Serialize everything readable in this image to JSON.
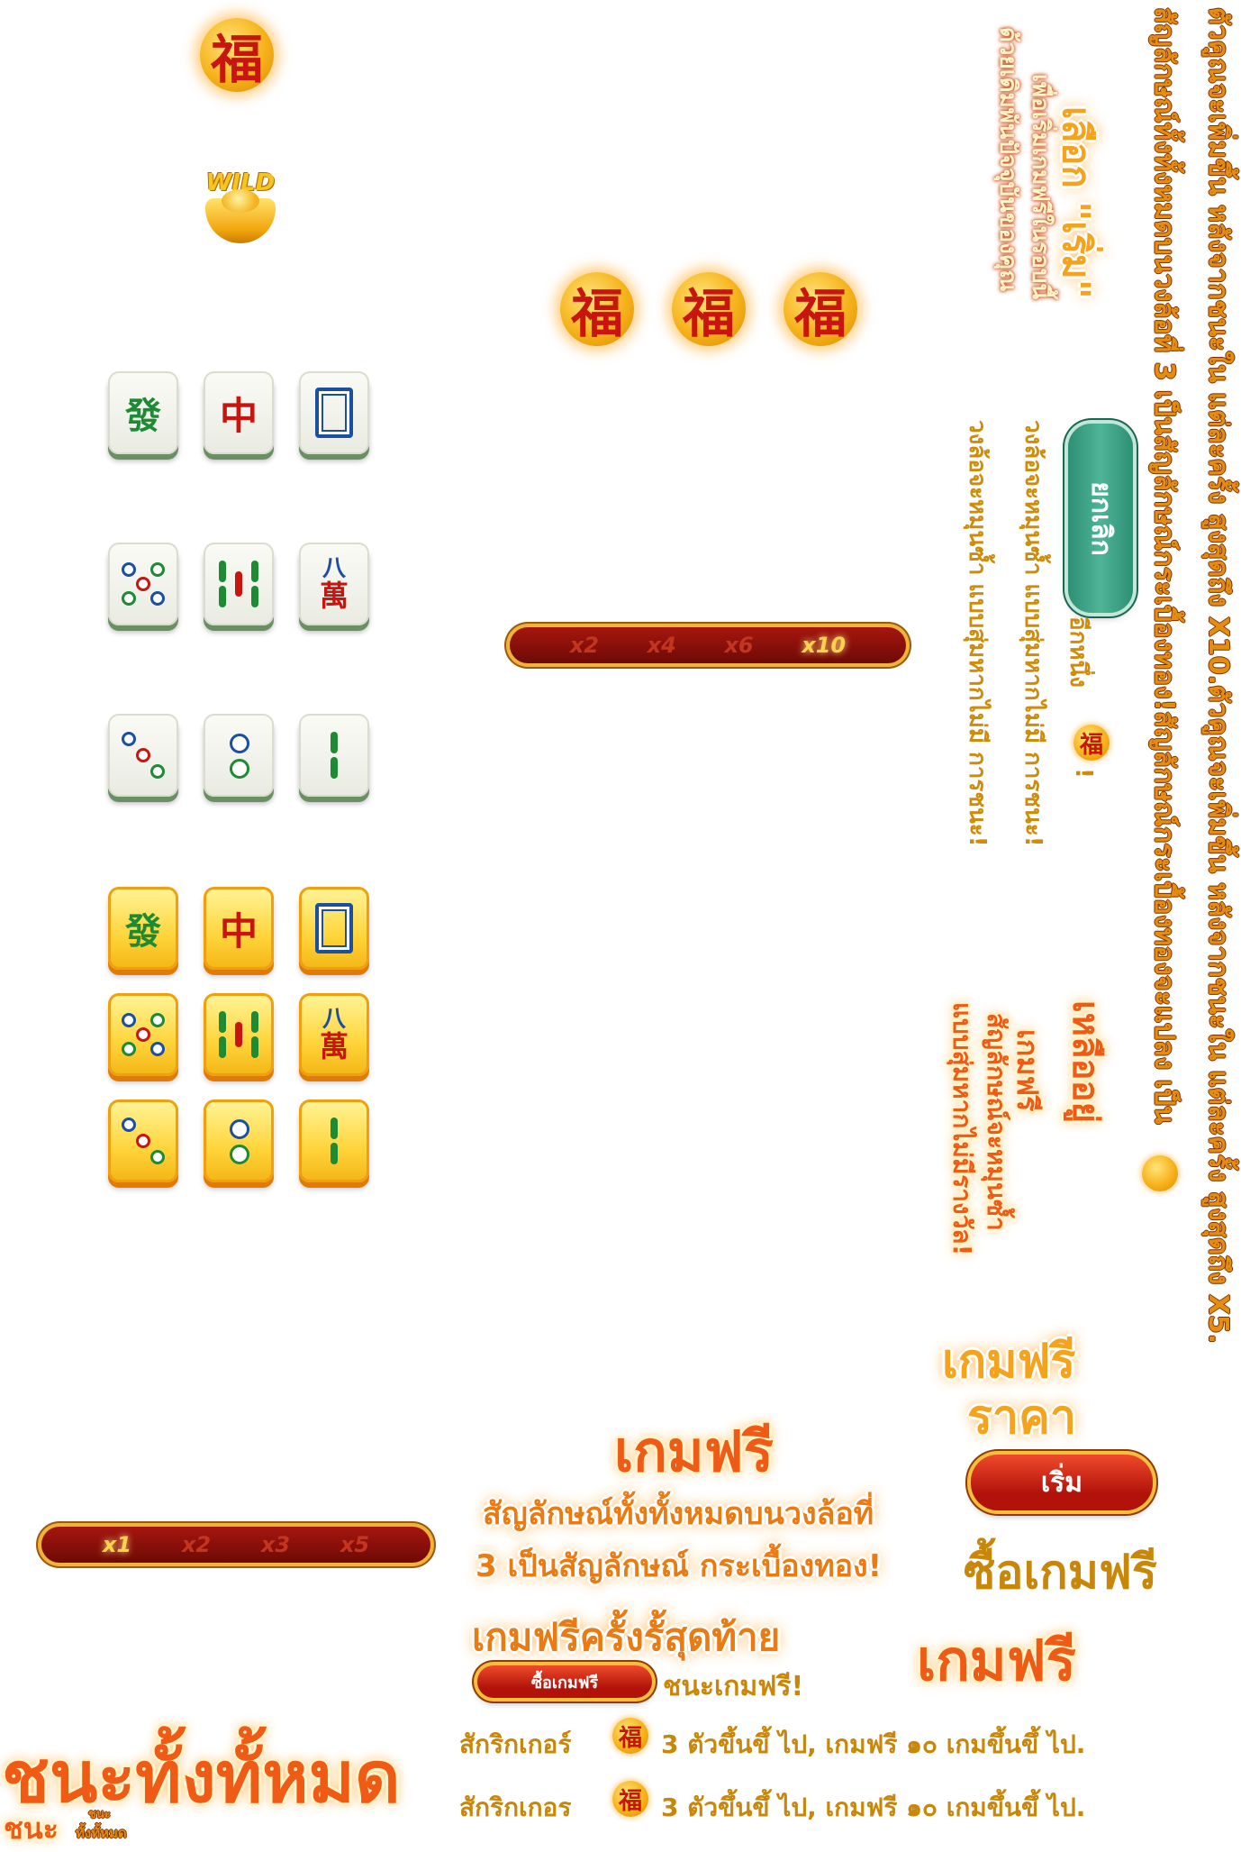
{
  "symbols": {
    "fu_char": "福",
    "wild_label": "WILD",
    "fu_row": [
      "福",
      "福",
      "福"
    ]
  },
  "tiles": {
    "fa": "發",
    "zhong": "中",
    "wan_top": "八",
    "wan_bottom": "萬"
  },
  "multipliers_top": [
    "x2",
    "x4",
    "x6",
    "x10"
  ],
  "multipliers_bottom": [
    "x1",
    "x2",
    "x3",
    "x5"
  ],
  "vertical": {
    "line1": "ตัวคูณจะเพิ่มขึ้น หลังจากชนะใน แต่ละครั้ง สูงสุดถึง X10.ตัวคูณจะเพิ่มขึ้น หลังจากชนะใน แต่ละครั้ง สูงสุดถึง X5.",
    "line2": "สัญลักษณ์ทั้งทั้งหมดบนวงล้อที่ 3 เป็นสัญลักษณ์กระเบื้องทอง!สัญลักษณ์กระเบื้องทองจะแปลง เป็น",
    "choose_title": "เลือก \"เริ่ม\"",
    "choose_sub1": "เพื่อเริ่มเกมฟรีในรอบนี้",
    "choose_sub2": "ด้วยเดิมพันปัจจุบันของคุณ",
    "cancel_button": "ยกเลิก",
    "one_more_prefix": "อีกหนึ่ง",
    "one_more_suffix": "!",
    "respin1": "วงล้อจะหมุนซ้ำ แบบสุ่มหากไม่มี การชนะ!",
    "respin2": "วงล้อจะหมุนซ้ำ แบบสุ่มหากไม่มี การชนะ!",
    "remaining": "เหลืออยู่",
    "freegame_v": "เกมฟรี",
    "symbol_respin": "สัญลักษณ์จะหมุนซ้ำ",
    "respin_no_win": "แบบสุ่มหากไม่มีรางวัล!"
  },
  "freegame_price": {
    "line1": "เกมฟรี",
    "line2": "ราคา"
  },
  "start_button": "เริ่ม",
  "buy_freegame": "ซื้อเกมฟรี",
  "freegame_big": "เกมฟรี",
  "freegame_title": "เกมฟรี",
  "freegame_desc1": "สัญลักษณ์ทั้งทั้งหมดบนวงล้อที่",
  "freegame_desc2": "3 เป็นสัญลักษณ์ กระเบื้องทอง!",
  "last_freegame": "เกมฟรีครั้งรั้สุดท้าย",
  "buy_small_button": "ซื้อเกมฟรี",
  "win_freegame": "ชนะเกมฟรี!",
  "scatter1": {
    "prefix": "สักริกเกอร์",
    "rest": "3 ตัวขึ้นขึ้ ไป, เกมฟรี ๑๐ เกมขึ้นขึ้ ไป."
  },
  "scatter2": {
    "prefix": "สักริกเกอร",
    "rest": "3 ตัวขึ้นขึ้ ไป, เกมฟรี ๑๐ เกมขึ้นขึ้ ไป."
  },
  "win_all_big": "ชนะทั้งทั้หมด",
  "win_small": "ชนะ",
  "win_tiny_top": "ชนะ",
  "win_tiny_bottom": "ทั้งทั้หมด",
  "colors": {
    "gold": "#f5a21c",
    "red": "#c8150f",
    "teal": "#2d8f75",
    "orange": "#ef5a14"
  }
}
